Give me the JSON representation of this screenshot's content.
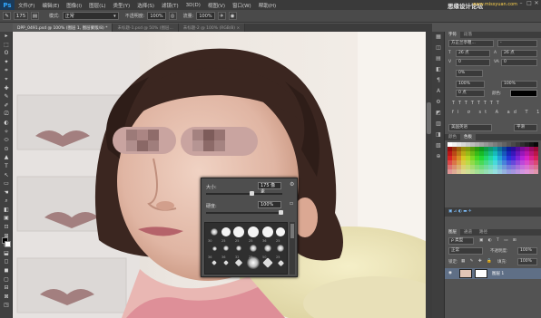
{
  "app": {
    "logo": "Ps"
  },
  "menu": [
    "文件(F)",
    "编辑(E)",
    "图像(I)",
    "图层(L)",
    "类型(Y)",
    "选择(S)",
    "滤镜(T)",
    "3D(D)",
    "视图(V)",
    "窗口(W)",
    "帮助(H)"
  ],
  "watermark": {
    "text": "思缘设计论坛",
    "site": "www.missyuan.com"
  },
  "window_controls": [
    "–",
    "□",
    "✕"
  ],
  "options": {
    "tool_icon": "brush-icon",
    "size_value": "175",
    "mode_label": "模式:",
    "mode_value": "正常",
    "opacity_label": "不透明度:",
    "opacity_value": "100%",
    "flow_label": "流量:",
    "flow_value": "100%"
  },
  "tabs": [
    {
      "label": "DPP_0491.psd @ 100% (图层 1, 图层蒙版/8) *",
      "active": true
    },
    {
      "label": "未标题-1.psd @ 50% (图层...",
      "active": false
    },
    {
      "label": "未标题-2 @ 100% (RGB/8) ×",
      "active": false
    }
  ],
  "toolbar": [
    "▸",
    "⬚",
    "ʘ",
    "✦",
    "⌗",
    "⌖",
    "✚",
    "✎",
    "✐",
    "⎚",
    "◐",
    "✧",
    "⬭",
    "⊙",
    "▲",
    "T",
    "↖",
    "▭",
    "☚",
    "⌕",
    "◧",
    "▣",
    "⊡",
    "⊞",
    "⬒",
    "⬓",
    "◻",
    "◼",
    "▢",
    "⊟",
    "⊠",
    "◳"
  ],
  "brush_panel": {
    "size_label": "大小:",
    "size_value": "175 像素",
    "hardness_label": "硬度:",
    "hardness_value": "100%",
    "size_fraction": 0.6,
    "hardness_fraction": 1.0,
    "preset_numbers": [
      "30",
      "25",
      "25",
      "25",
      "36",
      "25",
      "36",
      "36",
      "32",
      "25",
      "50",
      "25"
    ]
  },
  "right_panel": {
    "char_tabs": [
      "字符",
      "段落"
    ],
    "font_family": "方正兰亭粗...",
    "font_style": "-",
    "font_size": "26 点",
    "leading": "26 点",
    "kerning": "0",
    "tracking": "0",
    "scale_pct": "0%",
    "vscale": "100%",
    "hscale": "100%",
    "baseline": "0 点",
    "color_label": "颜色:",
    "lang": "美国英语",
    "aa": "平滑",
    "swatch_tabs": [
      "颜色",
      "色板"
    ],
    "layers_tabs": [
      "图层",
      "通道",
      "路径"
    ],
    "kind_label": "ρ 类型",
    "blend_mode": "正常",
    "opacity_label": "不透明度:",
    "opacity_value": "100%",
    "lock_label": "锁定:",
    "fill_label": "填充:",
    "fill_value": "100%",
    "layer_name": "图层 1"
  },
  "panel_strip": [
    "▦",
    "◫",
    "▤",
    "◧",
    "¶",
    "A",
    "⚙",
    "◩",
    "▥",
    "◨",
    "▧",
    "⊕"
  ],
  "colors": {
    "ui_bg": "#535353",
    "menubar": "#3a3a3a",
    "foreground_color": "#000000",
    "background_color": "#ffffff",
    "brand": "#31a8ff"
  }
}
